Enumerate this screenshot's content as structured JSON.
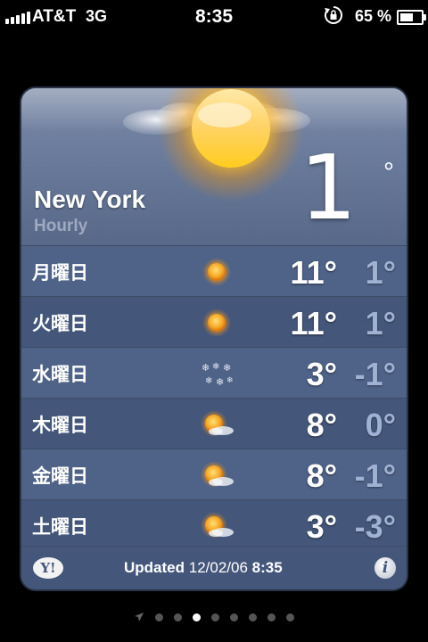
{
  "status": {
    "carrier": "AT&T",
    "network": "3G",
    "time": "8:35",
    "battery_percent": "65 %",
    "battery_level": 0.65,
    "signal_bars": 5
  },
  "weather": {
    "city": "New York",
    "subtitle": "Hourly",
    "current_temp": "1",
    "degree": "°",
    "current_icon": "sun-icon",
    "forecast": [
      {
        "day": "月曜日",
        "icon": "sun-icon",
        "high": "11°",
        "low": "1°"
      },
      {
        "day": "火曜日",
        "icon": "sun-icon",
        "high": "11°",
        "low": "1°"
      },
      {
        "day": "水曜日",
        "icon": "snow-icon",
        "high": "3°",
        "low": "-1°"
      },
      {
        "day": "木曜日",
        "icon": "partly-cloudy-icon",
        "high": "8°",
        "low": "0°"
      },
      {
        "day": "金曜日",
        "icon": "partly-cloudy-icon",
        "high": "8°",
        "low": "-1°"
      },
      {
        "day": "土曜日",
        "icon": "partly-cloudy-icon",
        "high": "3°",
        "low": "-3°"
      }
    ],
    "footer": {
      "provider_logo": "Y!",
      "updated_label": "Updated",
      "updated_date": "12/02/06",
      "updated_time": "8:35",
      "info_label": "i"
    }
  },
  "pager": {
    "page_count": 8,
    "active_index": 2
  }
}
